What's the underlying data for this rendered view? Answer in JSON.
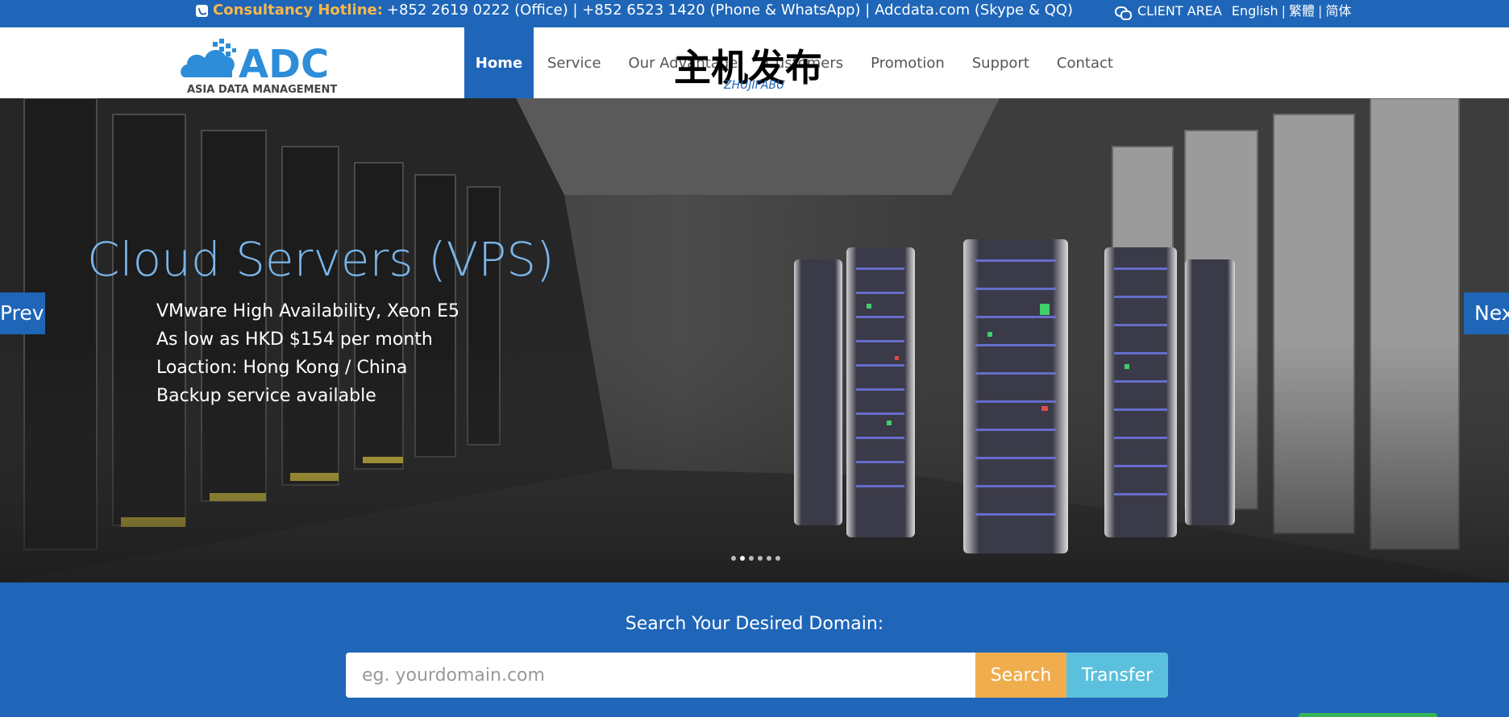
{
  "topbar": {
    "hotline_label": "Consultancy Hotline:",
    "hotline_text": "+852 2619 0222 (Office) | +852 6523 1420 (Phone & WhatsApp) | Adcdata.com (Skype & QQ)",
    "client_area": "CLIENT AREA",
    "languages": [
      "English",
      "繁體",
      "简体"
    ],
    "separator": "|",
    "icons": [
      "phone-icon",
      "chat-icon"
    ]
  },
  "logo": {
    "text": "ADC",
    "subtitle": "ASIA DATA MANAGEMENT"
  },
  "watermark": {
    "text": "主机发布",
    "subtext": "ZHUJIFABU"
  },
  "nav": {
    "items": [
      {
        "label": "Home",
        "active": true
      },
      {
        "label": "Service",
        "active": false
      },
      {
        "label": "Our Advantage",
        "active": false
      },
      {
        "label": "Customers",
        "active": false
      },
      {
        "label": "Promotion",
        "active": false
      },
      {
        "label": "Support",
        "active": false
      },
      {
        "label": "Contact",
        "active": false
      }
    ]
  },
  "hero": {
    "title": "Cloud Servers (VPS)",
    "lines": [
      "VMware High Availability, Xeon E5",
      "As low as HKD $154 per month",
      "Loaction: Hong Kong / China",
      "Backup service available"
    ],
    "prev_label": "Prev",
    "next_label": "Next",
    "slide_count": 6,
    "active_slide": 2
  },
  "domain_search": {
    "title": "Search Your Desired Domain:",
    "placeholder": "eg. yourdomain.com",
    "search_label": "Search",
    "transfer_label": "Transfer"
  },
  "colors": {
    "brand_blue": "#1f66b8",
    "hotline_orange": "#f7b84b",
    "hero_title": "#79b6ea",
    "search_button": "#f0ad4e",
    "transfer_button": "#5bc0de"
  }
}
